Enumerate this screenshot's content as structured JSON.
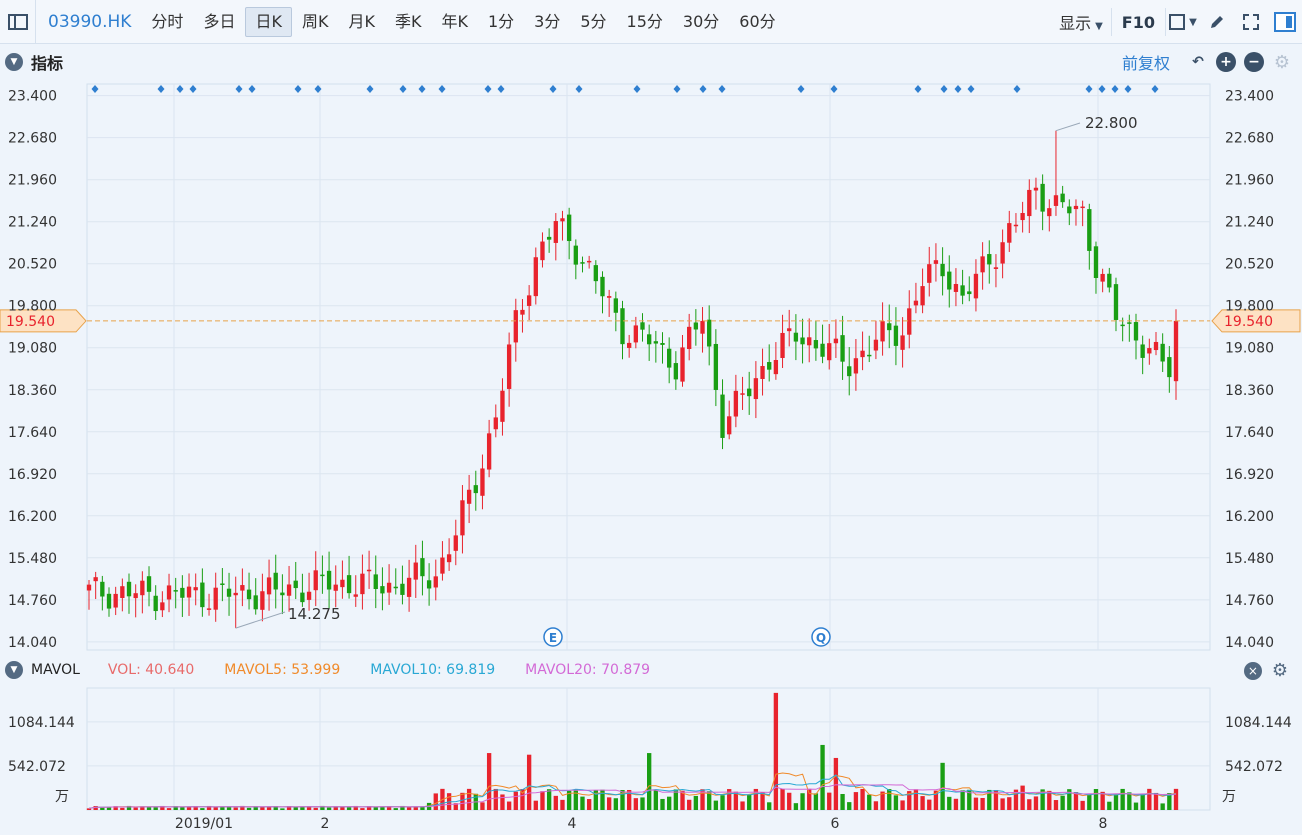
{
  "toolbar": {
    "stock_code": "03990.HK",
    "periods": [
      "分时",
      "多日",
      "日K",
      "周K",
      "月K",
      "季K",
      "年K",
      "1分",
      "3分",
      "5分",
      "15分",
      "30分",
      "60分"
    ],
    "active_period": "日K",
    "display_label": "显示",
    "f10_label": "F10"
  },
  "indicator_panel": {
    "title": "指标",
    "adjust_label": "前复权",
    "price_axis_labels": [
      "23.400",
      "22.680",
      "21.960",
      "21.240",
      "20.520",
      "19.800",
      "19.080",
      "18.360",
      "17.640",
      "16.920",
      "16.200",
      "15.480",
      "14.760",
      "14.040"
    ],
    "current_price": "19.540",
    "max_annotation": "22.800",
    "min_annotation": "14.275",
    "event_marker_e": "E",
    "event_marker_q": "Q"
  },
  "volume_panel": {
    "title": "MAVOL",
    "vol_label": "VOL:",
    "vol_value": "40.640",
    "mavol5_label": "MAVOL5:",
    "mavol5_value": "53.999",
    "mavol10_label": "MAVOL10:",
    "mavol10_value": "69.819",
    "mavol20_label": "MAVOL20:",
    "mavol20_value": "70.879",
    "axis_labels": [
      "1084.144",
      "542.072"
    ],
    "unit": "万"
  },
  "date_axis": [
    "2019/01",
    "2",
    "4",
    "6",
    "8"
  ],
  "colors": {
    "up": "#e8232d",
    "down": "#1a9e14",
    "vol": "#e86a6a",
    "mavol5": "#f08a2a",
    "mavol10": "#29a8d4",
    "mavol20": "#d36ad6",
    "accent": "#2f7fd0"
  },
  "chart_data": {
    "type": "candlestick",
    "ylim": [
      13.9,
      23.6
    ],
    "current_price": 19.54,
    "max": 22.8,
    "min": 14.275,
    "anchor_closes": [
      [
        0,
        14.9
      ],
      [
        10,
        14.85
      ],
      [
        20,
        14.85
      ],
      [
        28,
        14.9
      ],
      [
        36,
        15.05
      ],
      [
        46,
        15.0
      ],
      [
        52,
        15.2
      ],
      [
        55,
        15.9
      ],
      [
        58,
        16.8
      ],
      [
        61,
        17.9
      ],
      [
        64,
        19.5
      ],
      [
        67,
        20.6
      ],
      [
        70,
        21.2
      ],
      [
        73,
        20.8
      ],
      [
        76,
        20.2
      ],
      [
        80,
        19.4
      ],
      [
        84,
        19.2
      ],
      [
        88,
        18.8
      ],
      [
        92,
        19.6
      ],
      [
        95,
        17.8
      ],
      [
        98,
        18.2
      ],
      [
        102,
        18.9
      ],
      [
        106,
        19.3
      ],
      [
        110,
        19.1
      ],
      [
        114,
        18.8
      ],
      [
        118,
        19.2
      ],
      [
        122,
        19.4
      ],
      [
        125,
        20.2
      ],
      [
        128,
        20.5
      ],
      [
        131,
        19.9
      ],
      [
        135,
        20.6
      ],
      [
        139,
        21.2
      ],
      [
        142,
        21.8
      ],
      [
        145,
        21.5
      ],
      [
        149,
        21.4
      ],
      [
        151,
        20.5
      ],
      [
        154,
        19.6
      ],
      [
        157,
        19.3
      ],
      [
        160,
        18.9
      ],
      [
        162,
        18.7
      ],
      [
        163,
        19.54
      ]
    ],
    "volume_spikes": [
      [
        60,
        700
      ],
      [
        66,
        680
      ],
      [
        84,
        700
      ],
      [
        103,
        1440
      ],
      [
        110,
        800
      ],
      [
        112,
        640
      ],
      [
        128,
        580
      ],
      [
        140,
        300
      ],
      [
        148,
        220
      ]
    ],
    "volume_ylim": [
      0,
      1500
    ]
  }
}
